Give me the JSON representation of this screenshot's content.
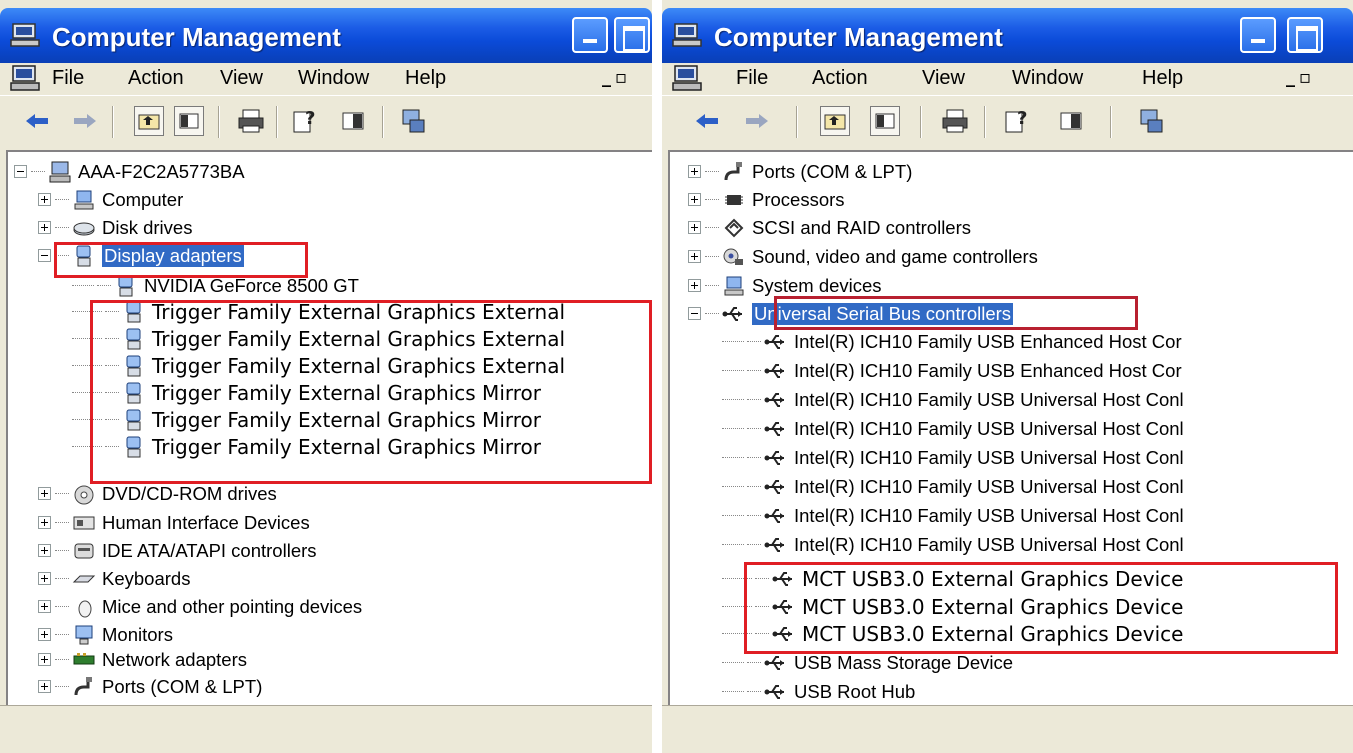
{
  "left": {
    "title": "Computer Management",
    "menu": [
      "File",
      "Action",
      "View",
      "Window",
      "Help"
    ],
    "root": "AAA-F2C2A5773BA",
    "items": [
      {
        "label": "Computer",
        "icon": "computer-icon"
      },
      {
        "label": "Disk drives",
        "icon": "disk-icon"
      },
      {
        "label": "Display adapters",
        "icon": "display-icon",
        "selected": true
      },
      {
        "label": "NVIDIA GeForce 8500 GT",
        "icon": "display-icon"
      },
      {
        "label": "Trigger Family External Graphics External",
        "icon": "display-icon"
      },
      {
        "label": "Trigger Family External Graphics External",
        "icon": "display-icon"
      },
      {
        "label": "Trigger Family External Graphics External",
        "icon": "display-icon"
      },
      {
        "label": "Trigger Family External Graphics Mirror",
        "icon": "display-icon"
      },
      {
        "label": "Trigger Family External Graphics Mirror",
        "icon": "display-icon"
      },
      {
        "label": "Trigger Family External Graphics Mirror",
        "icon": "display-icon"
      },
      {
        "label": "DVD/CD-ROM drives",
        "icon": "cdrom-icon"
      },
      {
        "label": "Human Interface Devices",
        "icon": "hid-icon"
      },
      {
        "label": "IDE ATA/ATAPI controllers",
        "icon": "ide-icon"
      },
      {
        "label": "Keyboards",
        "icon": "keyboard-icon"
      },
      {
        "label": "Mice and other pointing devices",
        "icon": "mouse-icon"
      },
      {
        "label": "Monitors",
        "icon": "monitor-icon"
      },
      {
        "label": "Network adapters",
        "icon": "network-icon"
      },
      {
        "label": "Ports (COM & LPT)",
        "icon": "port-icon"
      }
    ]
  },
  "right": {
    "title": "Computer Management",
    "menu": [
      "File",
      "Action",
      "View",
      "Window",
      "Help"
    ],
    "items": [
      {
        "label": "Ports (COM & LPT)",
        "icon": "port-icon"
      },
      {
        "label": "Processors",
        "icon": "processor-icon"
      },
      {
        "label": "SCSI and RAID controllers",
        "icon": "scsi-icon"
      },
      {
        "label": "Sound, video and game controllers",
        "icon": "sound-icon"
      },
      {
        "label": "System devices",
        "icon": "system-icon"
      },
      {
        "label": "Universal Serial Bus controllers",
        "icon": "usb-icon",
        "selected": true
      },
      {
        "label": "Intel(R) ICH10 Family USB Enhanced Host Cor",
        "icon": "usb-icon"
      },
      {
        "label": "Intel(R) ICH10 Family USB Enhanced Host Cor",
        "icon": "usb-icon"
      },
      {
        "label": "Intel(R) ICH10 Family USB Universal Host Conl",
        "icon": "usb-icon"
      },
      {
        "label": "Intel(R) ICH10 Family USB Universal Host Conl",
        "icon": "usb-icon"
      },
      {
        "label": "Intel(R) ICH10 Family USB Universal Host Conl",
        "icon": "usb-icon"
      },
      {
        "label": "Intel(R) ICH10 Family USB Universal Host Conl",
        "icon": "usb-icon"
      },
      {
        "label": "Intel(R) ICH10 Family USB Universal Host Conl",
        "icon": "usb-icon"
      },
      {
        "label": "Intel(R) ICH10 Family USB Universal Host Conl",
        "icon": "usb-icon"
      },
      {
        "label": "MCT USB3.0 External Graphics Device",
        "icon": "usb-icon"
      },
      {
        "label": "MCT USB3.0 External Graphics Device",
        "icon": "usb-icon"
      },
      {
        "label": "MCT USB3.0 External Graphics Device",
        "icon": "usb-icon"
      },
      {
        "label": "USB Mass Storage Device",
        "icon": "usb-icon"
      },
      {
        "label": "USB Root Hub",
        "icon": "usb-icon"
      }
    ]
  },
  "colors": {
    "highlight": "#e01e24",
    "selection": "#316ac5",
    "titlebar": "#0b4bd9"
  }
}
